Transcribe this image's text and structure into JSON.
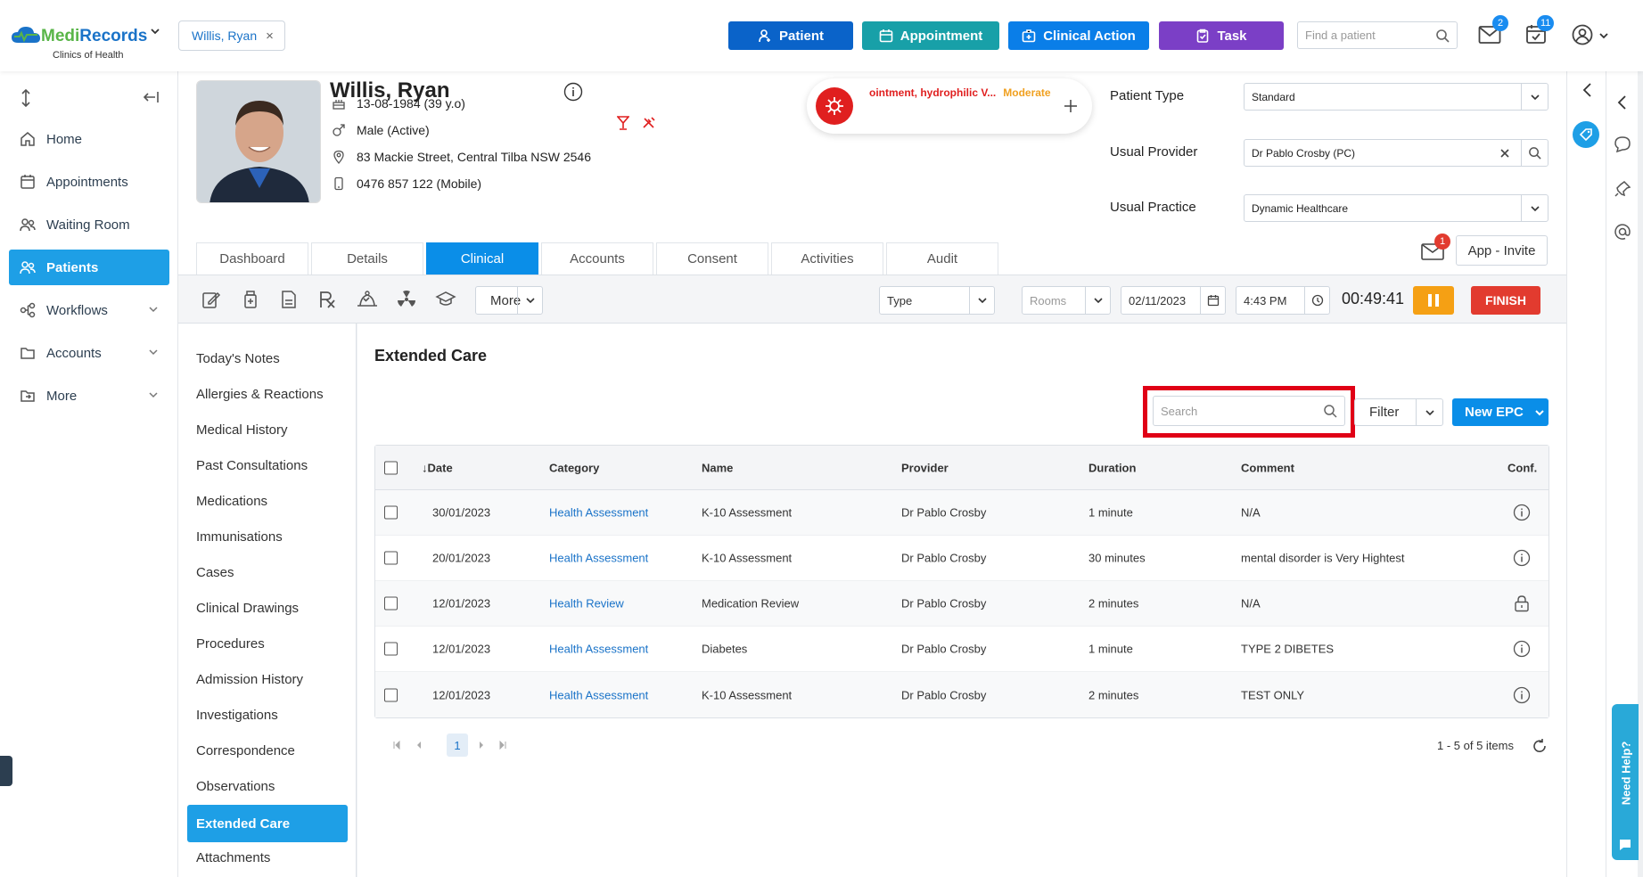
{
  "brand": {
    "name_part1": "Medi",
    "name_part2": "Records",
    "subtitle": "Clinics of Health"
  },
  "top_chip": {
    "label": "Willis, Ryan",
    "close": "×"
  },
  "top_buttons": {
    "patient": "Patient",
    "appointment": "Appointment",
    "clinical_action": "Clinical Action",
    "task": "Task"
  },
  "colors": {
    "patient": "#0a63c9",
    "appointment": "#18a0a8",
    "clinical_action": "#0a7ee8",
    "task": "#7b3fc6",
    "accent": "#1e9fe6",
    "highlight": "#e00016"
  },
  "find_patient": {
    "placeholder": "Find a patient"
  },
  "badges": {
    "mail": "2",
    "tasks": "11",
    "patient_mail": "1"
  },
  "sidebar": {
    "items": [
      {
        "label": "Home",
        "icon": "home-icon"
      },
      {
        "label": "Appointments",
        "icon": "calendar-icon"
      },
      {
        "label": "Waiting Room",
        "icon": "people-icon"
      },
      {
        "label": "Patients",
        "icon": "people-icon"
      },
      {
        "label": "Workflows",
        "icon": "workflow-icon"
      },
      {
        "label": "Accounts",
        "icon": "folder-icon"
      },
      {
        "label": "More",
        "icon": "folder-icon"
      }
    ]
  },
  "patient": {
    "name": "Willis, Ryan",
    "dob": "13-08-1984 (39 y.o)",
    "gender": "Male (Active)",
    "address": "83 Mackie Street, Central Tilba NSW 2546",
    "phone": "0476 857 122 (Mobile)"
  },
  "alert": {
    "text": "ointment, hydrophilic V...",
    "severity": "Moderate"
  },
  "fields": {
    "patient_type_label": "Patient Type",
    "patient_type": "Standard",
    "usual_provider_label": "Usual Provider",
    "usual_provider": "Dr Pablo Crosby (PC)",
    "usual_practice_label": "Usual Practice",
    "usual_practice": "Dynamic Healthcare"
  },
  "tabs": [
    "Dashboard",
    "Details",
    "Clinical",
    "Accounts",
    "Consent",
    "Activities",
    "Audit"
  ],
  "app_invite": "App - Invite",
  "toolbar": {
    "more": "More",
    "type_placeholder": "Type",
    "rooms_placeholder": "Rooms",
    "date": "02/11/2023",
    "time": "4:43 PM",
    "timer": "00:49:41",
    "finish": "FINISH"
  },
  "clinical_nav": [
    "Today's Notes",
    "Allergies & Reactions",
    "Medical History",
    "Past Consultations",
    "Medications",
    "Immunisations",
    "Cases",
    "Clinical Drawings",
    "Procedures",
    "Admission History",
    "Investigations",
    "Correspondence",
    "Observations",
    "Extended Care",
    "Attachments"
  ],
  "main": {
    "title": "Extended Care",
    "search_placeholder": "Search",
    "filter": "Filter",
    "new_epc": "New EPC"
  },
  "table": {
    "headers": {
      "date": "Date",
      "sort_arrow": "↓",
      "category": "Category",
      "name": "Name",
      "provider": "Provider",
      "duration": "Duration",
      "comment": "Comment",
      "conf": "Conf."
    },
    "rows": [
      {
        "date": "30/01/2023",
        "category": "Health Assessment",
        "name": "K-10 Assessment",
        "provider": "Dr Pablo Crosby",
        "duration": "1 minute",
        "comment": "N/A",
        "conf": "info-icon"
      },
      {
        "date": "20/01/2023",
        "category": "Health Assessment",
        "name": "K-10 Assessment",
        "provider": "Dr Pablo Crosby",
        "duration": "30 minutes",
        "comment": "mental disorder is Very Hightest",
        "conf": "info-icon"
      },
      {
        "date": "12/01/2023",
        "category": "Health Review",
        "name": "Medication Review",
        "provider": "Dr Pablo Crosby",
        "duration": "2 minutes",
        "comment": "N/A",
        "conf": "lock-icon"
      },
      {
        "date": "12/01/2023",
        "category": "Health Assessment",
        "name": "Diabetes",
        "provider": "Dr Pablo Crosby",
        "duration": "1 minute",
        "comment": "TYPE 2 DIBETES",
        "conf": "info-icon"
      },
      {
        "date": "12/01/2023",
        "category": "Health Assessment",
        "name": "K-10 Assessment",
        "provider": "Dr Pablo Crosby",
        "duration": "2 minutes",
        "comment": "TEST ONLY",
        "conf": "info-icon"
      }
    ]
  },
  "pager": {
    "current": "1",
    "info": "1 - 5 of 5 items"
  },
  "help": "Need Help?"
}
